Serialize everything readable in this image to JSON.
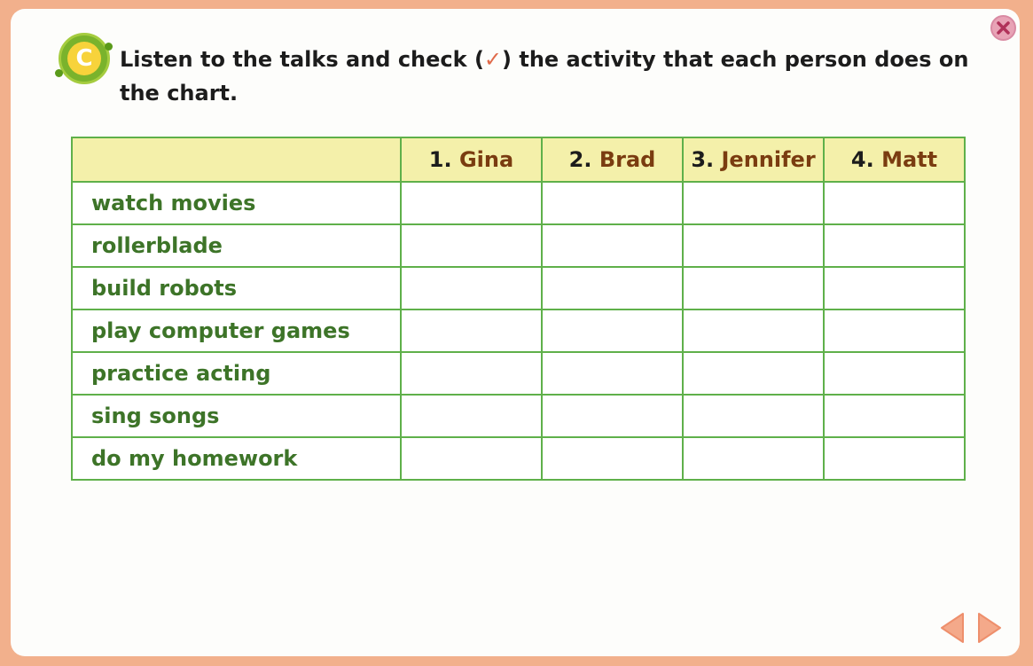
{
  "section": {
    "badge_letter": "C"
  },
  "instruction": {
    "before": "Listen to the talks and check (",
    "check_symbol": "✓",
    "after": ") the activity that each person does on the chart."
  },
  "table": {
    "columns": [
      {
        "num": "1. ",
        "name": "Gina"
      },
      {
        "num": "2. ",
        "name": "Brad"
      },
      {
        "num": "3. ",
        "name": "Jennifer"
      },
      {
        "num": "4. ",
        "name": "Matt"
      }
    ],
    "rows": [
      "watch movies",
      "rollerblade",
      "build robots",
      "play computer games",
      "practice acting",
      "sing songs",
      "do my homework"
    ]
  },
  "icons": {
    "close": "close-icon",
    "prev": "arrow-left-icon",
    "next": "arrow-right-icon",
    "badge": "section-badge-icon"
  },
  "colors": {
    "frame": "#f2b08c",
    "grid_border": "#5fb04a",
    "header_fill": "#f4f0aa",
    "activity_text": "#3d7428",
    "name_text": "#7a3c10",
    "nav_arrow": "#f4a98a"
  }
}
